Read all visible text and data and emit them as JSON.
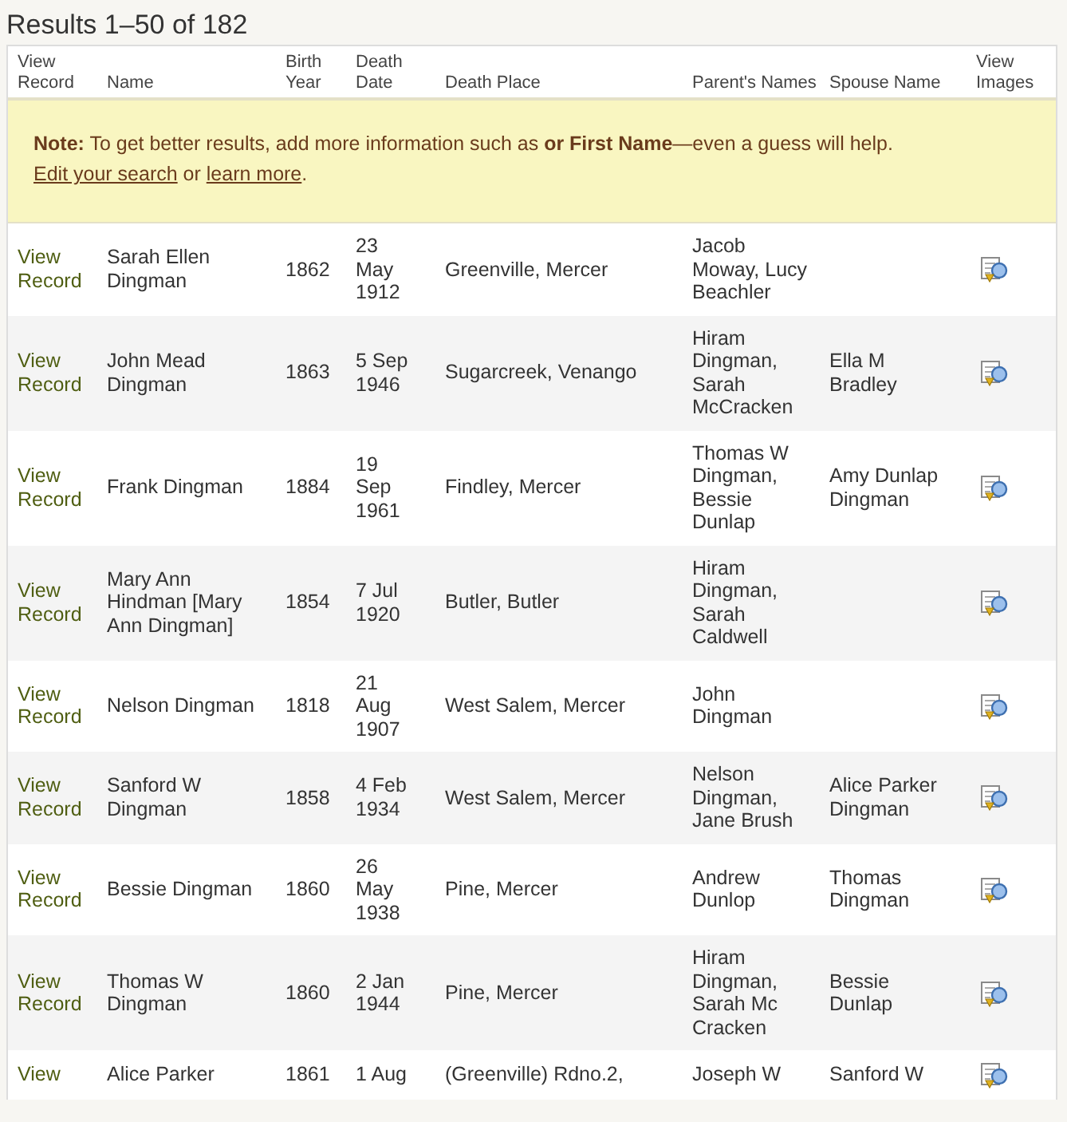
{
  "title": "Results 1–50 of 182",
  "columns": [
    "View Record",
    "Name",
    "Birth Year",
    "Death Date",
    "Death Place",
    "Parent's Names",
    "Spouse Name",
    "View Images"
  ],
  "note": {
    "parts": [
      {
        "kind": "text",
        "text": "**Note:** To get better results, add more information such as **or First Name**—even a guess will help. "
      },
      {
        "kind": "link",
        "text": "Edit your search"
      },
      {
        "kind": "text",
        "text": " or "
      },
      {
        "kind": "link",
        "text": "learn more"
      },
      {
        "kind": "text",
        "text": "."
      }
    ]
  },
  "rows": [
    {
      "view": "View Record",
      "name": "Sarah Ellen Dingman",
      "birth_year": "1862",
      "death_date": "23 May 1912",
      "death_place": "Greenville, Mercer",
      "parents": "Jacob Moway, Lucy Beachler"
    },
    {
      "view": "View Record",
      "name": "John Mead Dingman",
      "birth_year": "1863",
      "death_date": "5 Sep 1946",
      "death_place": "Sugarcreek, Venango",
      "parents": "Hiram Dingman, Sarah McCracken",
      "spouse": "Ella M Bradley"
    },
    {
      "view": "View Record",
      "name": "Frank Dingman",
      "birth_year": "1884",
      "death_date": "19 Sep 1961",
      "death_place": "Findley, Mercer",
      "parents": "Thomas W Dingman, Bessie Dunlap",
      "spouse": "Amy Dunlap Dingman"
    },
    {
      "view": "View Record",
      "name": "Mary Ann Hindman [Mary Ann Dingman]",
      "birth_year": "1854",
      "death_date": "7 Jul 1920",
      "death_place": "Butler, Butler",
      "parents": "Hiram Dingman, Sarah Caldwell"
    },
    {
      "view": "View Record",
      "name": "Nelson Dingman",
      "birth_year": "1818",
      "death_date": "21 Aug 1907",
      "death_place": "West Salem, Mercer",
      "parents": "John Dingman"
    },
    {
      "view": "View Record",
      "name": "Sanford W Dingman",
      "birth_year": "1858",
      "death_date": "4 Feb 1934",
      "death_place": "West Salem, Mercer",
      "parents": "Nelson Dingman, Jane Brush",
      "spouse": "Alice Parker Dingman"
    },
    {
      "view": "View Record",
      "name": "Bessie Dingman",
      "birth_year": "1860",
      "death_date": "26 May 1938",
      "death_place": "Pine, Mercer",
      "parents": "Andrew Dunlop",
      "spouse": "Thomas Dingman"
    },
    {
      "view": "View Record",
      "name": "Thomas W Dingman",
      "birth_year": "1860",
      "death_date": "2 Jan 1944",
      "death_place": "Pine, Mercer",
      "parents": "Hiram Dingman, Sarah Mc Cracken",
      "spouse": "Bessie Dunlap"
    },
    {
      "view": "View",
      "name": "Alice Parker",
      "birth_year": "1861",
      "death_date": "1 Aug",
      "death_place": "(Greenville) Rdno.2,",
      "parents": "Joseph W",
      "spouse": "Sanford W"
    }
  ]
}
